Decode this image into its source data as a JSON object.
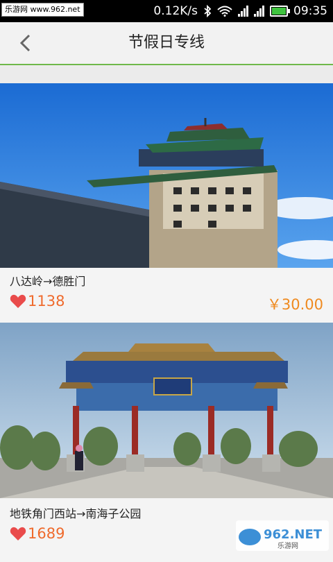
{
  "statusbar": {
    "watermark": "乐游网 www.962.net",
    "speed": "0.12K/s",
    "time": "09:35",
    "icons": [
      "bluetooth-icon",
      "wifi-icon",
      "signal-icon",
      "signal-icon",
      "battery-icon"
    ]
  },
  "header": {
    "title": "节假日专线",
    "back_icon": "chevron-left-icon"
  },
  "routes": [
    {
      "route": "八达岭→德胜门",
      "likes": "1138",
      "price": "￥30.00",
      "image": "city-gate-tower-photo"
    },
    {
      "route": "地铁角门西站→南海子公园",
      "likes": "1689",
      "image": "park-archway-photo"
    }
  ],
  "colors": {
    "accent_green": "#6fb84a",
    "like_red": "#e94b4b",
    "price_orange": "#ef8a1f"
  },
  "logo": {
    "text": "962.NET",
    "subtext": "乐游网"
  }
}
